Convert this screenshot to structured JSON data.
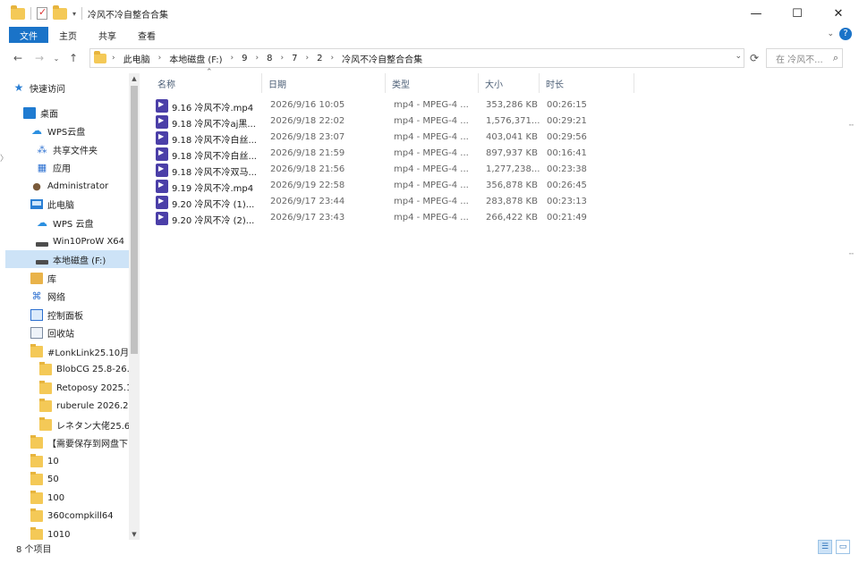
{
  "window": {
    "title": "冷风不冷自整合合集",
    "controls": {
      "minimize": "—",
      "maximize": "☐",
      "close": "✕"
    }
  },
  "ribbon": {
    "tabs": [
      "文件",
      "主页",
      "共享",
      "查看"
    ],
    "collapse_icon": "chevron-down-icon",
    "help_label": "?"
  },
  "address": {
    "crumbs": [
      "此电脑",
      "本地磁盘 (F:)",
      "9",
      "8",
      "7",
      "2",
      "冷风不冷自整合合集"
    ],
    "search_placeholder": "在 冷风不...  ",
    "search_icon": "search-icon"
  },
  "sidebar": {
    "items": [
      {
        "label": "快速访问",
        "icon": "star-icon"
      },
      {
        "label": "桌面",
        "icon": "desktop-icon"
      },
      {
        "label": "WPS云盘",
        "icon": "cloud-icon"
      },
      {
        "label": "共享文件夹",
        "icon": "share-icon"
      },
      {
        "label": "应用",
        "icon": "apps-icon"
      },
      {
        "label": "Administrator",
        "icon": "user-icon"
      },
      {
        "label": "此电脑",
        "icon": "pc-icon"
      },
      {
        "label": "WPS 云盘",
        "icon": "cloud-icon"
      },
      {
        "label": "Win10ProW X64",
        "icon": "drive-icon"
      },
      {
        "label": "本地磁盘 (F:)",
        "icon": "drive-icon"
      },
      {
        "label": "库",
        "icon": "library-icon"
      },
      {
        "label": "网络",
        "icon": "network-icon"
      },
      {
        "label": "控制面板",
        "icon": "control-panel-icon"
      },
      {
        "label": "回收站",
        "icon": "recycle-bin-icon"
      },
      {
        "label": "#LonkLink25.10月",
        "icon": "folder-icon"
      },
      {
        "label": "BlobCG 25.8-26.",
        "icon": "folder-icon"
      },
      {
        "label": "Retoposy 2025.1",
        "icon": "folder-icon"
      },
      {
        "label": "ruberule 2026.2.",
        "icon": "folder-icon"
      },
      {
        "label": "レネタン大佬25.6",
        "icon": "folder-icon"
      },
      {
        "label": "【需要保存到网盘下",
        "icon": "folder-icon"
      },
      {
        "label": "10",
        "icon": "folder-icon"
      },
      {
        "label": "50",
        "icon": "folder-icon"
      },
      {
        "label": "100",
        "icon": "folder-icon"
      },
      {
        "label": "360compkill64",
        "icon": "folder-icon"
      },
      {
        "label": "1010",
        "icon": "folder-icon"
      }
    ]
  },
  "columns": [
    "名称",
    "日期",
    "类型",
    "大小",
    "时长"
  ],
  "files": [
    {
      "name": "9.16 冷风不冷.mp4",
      "date": "2026/9/16 10:05",
      "type": "mp4 - MPEG-4 ...",
      "size": "353,286 KB",
      "duration": "00:26:15"
    },
    {
      "name": "9.18 冷风不冷aj黑...",
      "date": "2026/9/18 22:02",
      "type": "mp4 - MPEG-4 ...",
      "size": "1,576,371...",
      "duration": "00:29:21"
    },
    {
      "name": "9.18 冷风不冷白丝...",
      "date": "2026/9/18 23:07",
      "type": "mp4 - MPEG-4 ...",
      "size": "403,041 KB",
      "duration": "00:29:56"
    },
    {
      "name": "9.18 冷风不冷白丝...",
      "date": "2026/9/18 21:59",
      "type": "mp4 - MPEG-4 ...",
      "size": "897,937 KB",
      "duration": "00:16:41"
    },
    {
      "name": "9.18 冷风不冷双马...",
      "date": "2026/9/18 21:56",
      "type": "mp4 - MPEG-4 ...",
      "size": "1,277,238...",
      "duration": "00:23:38"
    },
    {
      "name": "9.19 冷风不冷.mp4",
      "date": "2026/9/19 22:58",
      "type": "mp4 - MPEG-4 ...",
      "size": "356,878 KB",
      "duration": "00:26:45"
    },
    {
      "name": "9.20 冷风不冷 (1)...",
      "date": "2026/9/17 23:44",
      "type": "mp4 - MPEG-4 ...",
      "size": "283,878 KB",
      "duration": "00:23:13"
    },
    {
      "name": "9.20 冷风不冷 (2)...",
      "date": "2026/9/17 23:43",
      "type": "mp4 - MPEG-4 ...",
      "size": "266,422 KB",
      "duration": "00:21:49"
    }
  ],
  "status": {
    "count": "8 个项目"
  },
  "colors": {
    "accent": "#1a73c8",
    "selection": "#cde3f7",
    "video_icon": "#4b3fa8",
    "folder": "#f4c957"
  }
}
